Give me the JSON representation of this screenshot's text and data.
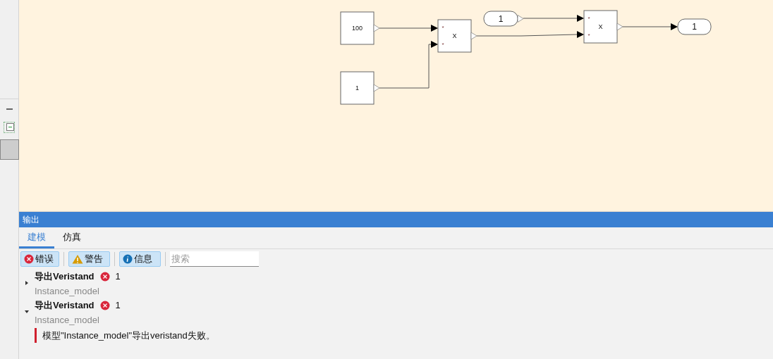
{
  "sidebar": {
    "tools": [
      {
        "kind": "collapse"
      },
      {
        "kind": "tree"
      },
      {
        "kind": "slot"
      }
    ]
  },
  "diagram": {
    "blocks": [
      {
        "kind": "constant",
        "label": "100"
      },
      {
        "kind": "constant",
        "label": "1"
      },
      {
        "kind": "product",
        "symbol": "X",
        "input_signs": [
          "*",
          "*"
        ]
      },
      {
        "kind": "inport",
        "label": "1"
      },
      {
        "kind": "product",
        "symbol": "X",
        "input_signs": [
          "*",
          "*"
        ]
      },
      {
        "kind": "outport",
        "label": "1"
      }
    ]
  },
  "output_panel": {
    "title": "输出",
    "tabs": [
      {
        "label": "建模",
        "selected": true
      },
      {
        "label": "仿真",
        "selected": false
      }
    ],
    "filters": [
      {
        "kind": "error",
        "label": "错误",
        "pressed": true
      },
      {
        "kind": "warning",
        "label": "警告",
        "pressed": true
      },
      {
        "kind": "info",
        "label": "信息",
        "pressed": true
      }
    ],
    "search": {
      "placeholder": "搜索"
    },
    "messages": [
      {
        "title": "导出Veristand",
        "count": "1",
        "source": "Instance_model",
        "expanded": false
      },
      {
        "title": "导出Veristand",
        "count": "1",
        "source": "Instance_model",
        "expanded": true,
        "details": [
          "模型\"Instance_model\"导出veristand失败。"
        ]
      }
    ]
  }
}
